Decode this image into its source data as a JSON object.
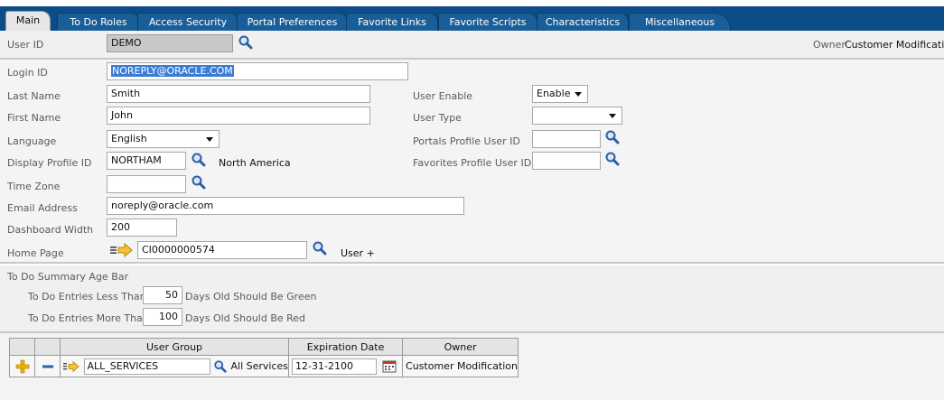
{
  "tabs": [
    {
      "label": "Main",
      "active": true
    },
    {
      "label": "To Do Roles"
    },
    {
      "label": "Access Security"
    },
    {
      "label": "Portal Preferences"
    },
    {
      "label": "Favorite Links"
    },
    {
      "label": "Favorite Scripts"
    },
    {
      "label": "Characteristics"
    },
    {
      "label": "Miscellaneous"
    }
  ],
  "header": {
    "user_id_label": "User ID",
    "user_id_value": "DEMO",
    "owner_label": "Owner",
    "owner_value": "Customer Modification"
  },
  "form": {
    "login_id_label": "Login ID",
    "login_id_value": "NOREPLY@ORACLE.COM",
    "last_name_label": "Last Name",
    "last_name_value": "Smith",
    "first_name_label": "First Name",
    "first_name_value": "John",
    "language_label": "Language",
    "language_value": "English",
    "display_profile_label": "Display Profile ID",
    "display_profile_value": "NORTHAM",
    "display_profile_desc": "North America",
    "time_zone_label": "Time Zone",
    "time_zone_value": "",
    "email_label": "Email Address",
    "email_value": "noreply@oracle.com",
    "dashboard_width_label": "Dashboard Width",
    "dashboard_width_value": "200",
    "home_page_label": "Home Page",
    "home_page_value": "CI0000000574",
    "home_page_desc": "User +",
    "user_enable_label": "User Enable",
    "user_enable_value": "Enable",
    "user_type_label": "User Type",
    "user_type_value": "",
    "portals_profile_label": "Portals Profile User ID",
    "portals_profile_value": "",
    "favorites_profile_label": "Favorites Profile User ID",
    "favorites_profile_value": ""
  },
  "age_bar": {
    "title": "To Do Summary Age Bar",
    "less_than_label": "To Do Entries Less Than",
    "less_than_value": "50",
    "less_than_suffix": "Days Old Should Be Green",
    "more_than_label": "To Do Entries More Than",
    "more_than_value": "100",
    "more_than_suffix": "Days Old Should Be Red"
  },
  "grid": {
    "columns": [
      "User Group",
      "Expiration Date",
      "Owner"
    ],
    "rows": [
      {
        "user_group": "ALL_SERVICES",
        "user_group_desc": "All Services",
        "expiration_date": "12-31-2100",
        "owner": "Customer Modification"
      }
    ]
  },
  "colors": {
    "tab_bar": "#0c4d87",
    "selection": "#3a7bd5",
    "add_icon": "#f0b400",
    "remove_icon": "#2a62b8"
  }
}
